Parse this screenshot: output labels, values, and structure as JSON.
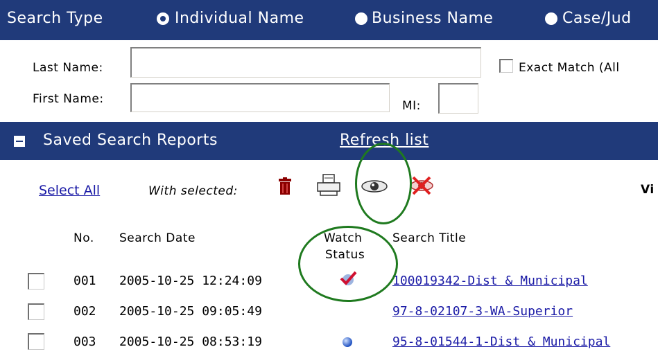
{
  "search_type": {
    "label": "Search Type",
    "options": [
      {
        "label": "Individual Name",
        "selected": true
      },
      {
        "label": "Business Name",
        "selected": false
      },
      {
        "label": "Case/Jud",
        "selected": false
      }
    ]
  },
  "form": {
    "last_name_label": "Last Name:",
    "first_name_label": "First Name:",
    "mi_label": "MI:",
    "exact_match_label": "Exact Match (All",
    "last_name_value": "",
    "first_name_value": "",
    "mi_value": ""
  },
  "saved_reports": {
    "title": "Saved Search Reports",
    "refresh_label": "Refresh list"
  },
  "toolbar": {
    "select_all": "Select All",
    "with_selected": "With selected:",
    "vi_cut": "Vi"
  },
  "table": {
    "columns": {
      "no": "No.",
      "date": "Search Date",
      "watch_line1": "Watch",
      "watch_line2": "Status",
      "title": "Search Title"
    },
    "rows": [
      {
        "no": "001",
        "date": "2005-10-25 12:24:09",
        "watch": "checkmark",
        "title": "100019342-Dist & Municipal"
      },
      {
        "no": "002",
        "date": "2005-10-25 09:05:49",
        "watch": "none",
        "title": "97-8-02107-3-WA-Superior"
      },
      {
        "no": "003",
        "date": "2005-10-25 08:53:19",
        "watch": "blue-dot",
        "title": "95-8-01544-1-Dist & Municipal"
      }
    ]
  },
  "colors": {
    "header_bar": "#203a7a",
    "link": "#1a1aa6",
    "annotation_circle": "#1f7a1f"
  }
}
